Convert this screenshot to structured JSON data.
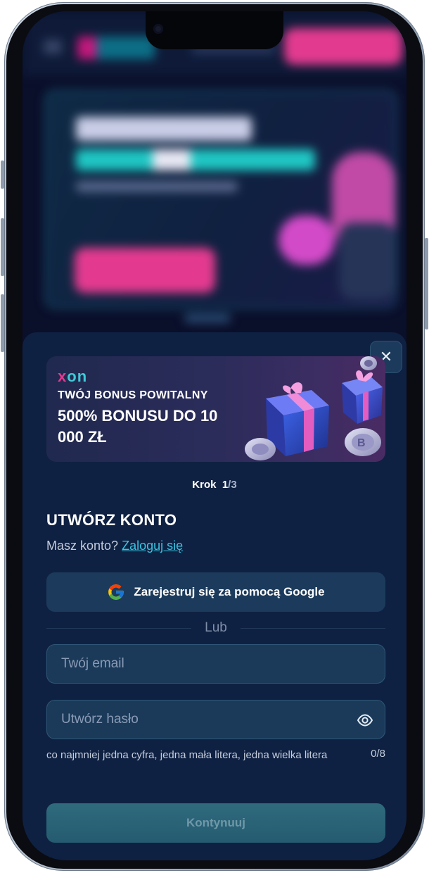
{
  "modal": {
    "close_label": "✕",
    "promo": {
      "logo_x": "x",
      "logo_on": "on",
      "subtitle": "TWÓJ BONUS POWITALNY",
      "headline": "500% BONUSU DO 10 000 ZŁ"
    },
    "step": {
      "label": "Krok",
      "current": "1",
      "total": "/3"
    },
    "title": "UTWÓRZ KONTO",
    "login": {
      "question": "Masz konto?",
      "link": "Zaloguj się"
    },
    "google_button": "Zarejestruj się za pomocą Google",
    "or": "Lub",
    "email": {
      "placeholder": "Twój email",
      "value": ""
    },
    "password": {
      "placeholder": "Utwórz hasło",
      "value": ""
    },
    "password_hint": "co najmniej jedna cyfra, jedna mała litera, jedna wielka litera",
    "password_counter": "0/8",
    "continue_button": "Kontynuuj"
  },
  "icons": {
    "close": "close-icon",
    "google": "google-icon",
    "eye": "eye-icon"
  },
  "colors": {
    "modal_bg": "#0f2142",
    "accent_cyan": "#37c5e2",
    "brand_pink": "#e23a8f",
    "input_bg": "#1b3a5a"
  }
}
